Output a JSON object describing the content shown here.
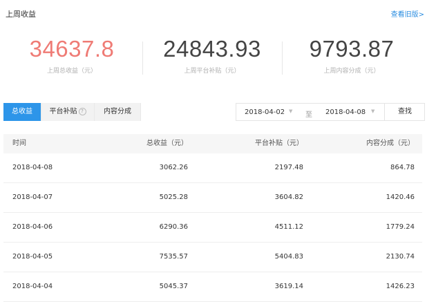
{
  "header": {
    "title": "上周收益",
    "old_version_link": "查看旧版>"
  },
  "stats": [
    {
      "value": "34637.8",
      "label": "上周总收益（元）"
    },
    {
      "value": "24843.93",
      "label": "上周平台补贴（元）"
    },
    {
      "value": "9793.87",
      "label": "上周内容分成（元）"
    }
  ],
  "tabs": [
    {
      "label": "总收益",
      "active": true
    },
    {
      "label": "平台补贴",
      "help_icon": "?"
    },
    {
      "label": "内容分成"
    }
  ],
  "date_range": {
    "start": "2018-04-02",
    "separator": "至",
    "end": "2018-04-08",
    "search_label": "查找"
  },
  "table": {
    "headers": [
      "时间",
      "总收益（元）",
      "平台补贴（元）",
      "内容分成（元）"
    ],
    "rows": [
      [
        "2018-04-08",
        "3062.26",
        "2197.48",
        "864.78"
      ],
      [
        "2018-04-07",
        "5025.28",
        "3604.82",
        "1420.46"
      ],
      [
        "2018-04-06",
        "6290.36",
        "4511.12",
        "1779.24"
      ],
      [
        "2018-04-05",
        "7535.57",
        "5404.83",
        "2130.74"
      ],
      [
        "2018-04-04",
        "5045.37",
        "3619.14",
        "1426.23"
      ]
    ]
  },
  "colors": {
    "accent": "#2d95e9",
    "highlight_value": "#ef7b75",
    "link": "#2a8de0"
  }
}
